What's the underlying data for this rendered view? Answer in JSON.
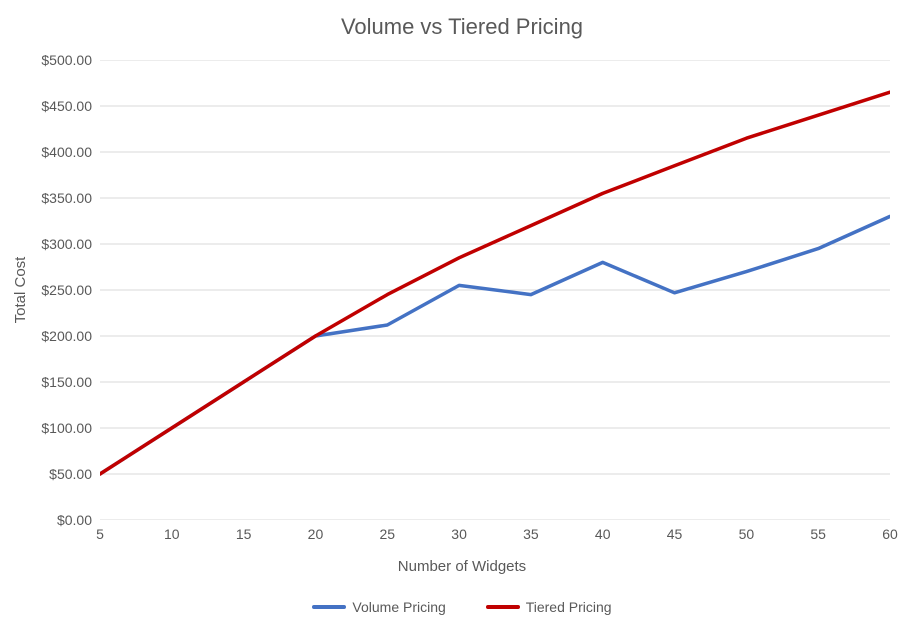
{
  "chart_data": {
    "type": "line",
    "title": "Volume vs Tiered Pricing",
    "xlabel": "Number of Widgets",
    "ylabel": "Total Cost",
    "categories": [
      5,
      10,
      15,
      20,
      25,
      30,
      35,
      40,
      45,
      50,
      55,
      60
    ],
    "y_ticks": [
      0,
      50,
      100,
      150,
      200,
      250,
      300,
      350,
      400,
      450,
      500
    ],
    "y_tick_labels": [
      "$0.00",
      "$50.00",
      "$100.00",
      "$150.00",
      "$200.00",
      "$250.00",
      "$300.00",
      "$350.00",
      "$400.00",
      "$450.00",
      "$500.00"
    ],
    "ylim": [
      0,
      500
    ],
    "series": [
      {
        "name": "Volume Pricing",
        "color": "#4472C4",
        "class": "volume",
        "values": [
          50,
          100,
          150,
          200,
          212,
          255,
          245,
          280,
          247,
          270,
          295,
          330
        ]
      },
      {
        "name": "Tiered Pricing",
        "color": "#C00000",
        "class": "tiered",
        "values": [
          50,
          100,
          150,
          200,
          245,
          285,
          320,
          355,
          385,
          415,
          440,
          465
        ]
      }
    ],
    "legend_position": "bottom"
  }
}
